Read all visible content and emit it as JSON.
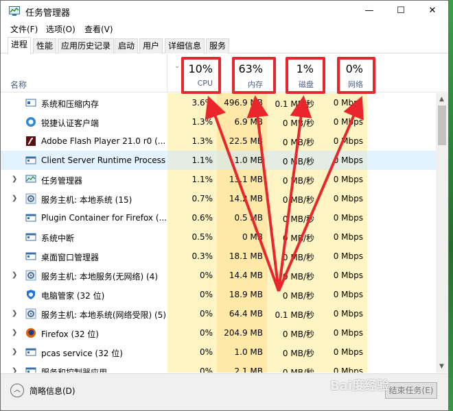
{
  "window": {
    "title": "任务管理器"
  },
  "window_controls": {
    "minimize": "—",
    "maximize": "☐",
    "close": "✕"
  },
  "menu": [
    "文件(F)",
    "选项(O)",
    "查看(V)"
  ],
  "tabs": [
    "进程",
    "性能",
    "应用历史记录",
    "启动",
    "用户",
    "详细信息",
    "服务"
  ],
  "active_tab": "进程",
  "header": {
    "name_label": "名称",
    "cpu": {
      "percent": "10%",
      "label": "CPU"
    },
    "memory": {
      "percent": "63%",
      "label": "内存"
    },
    "disk": {
      "percent": "1%",
      "label": "磁盘"
    },
    "network": {
      "percent": "0%",
      "label": "网络"
    }
  },
  "processes": [
    {
      "name": "系统和压缩内存",
      "cpu": "3.6%",
      "mem": "496.9 MB",
      "disk": "0.1 MB/秒",
      "net": "0 Mbps",
      "expandable": false,
      "icon": "system-icon"
    },
    {
      "name": "锐捷认证客户端",
      "cpu": "1.3%",
      "mem": "6.9 MB",
      "disk": "0 MB/秒",
      "net": "0 Mbps",
      "expandable": false,
      "icon": "ruijie-icon"
    },
    {
      "name": "Adobe Flash Player 21.0 r0 (...",
      "cpu": "1.3%",
      "mem": "22.5 MB",
      "disk": "0 MB/秒",
      "net": "0 Mbps",
      "expandable": false,
      "icon": "flash-icon"
    },
    {
      "name": "Client Server Runtime Process",
      "cpu": "1.1%",
      "mem": "1.0 MB",
      "disk": "0 MB/秒",
      "net": "0 Mbps",
      "expandable": false,
      "icon": "window-icon",
      "selected": true
    },
    {
      "name": "任务管理器",
      "cpu": "1.1%",
      "mem": "13.1 MB",
      "disk": "0 MB/秒",
      "net": "0 Mbps",
      "expandable": true,
      "icon": "taskmgr-icon"
    },
    {
      "name": "服务主机: 本地系统 (15)",
      "cpu": "0.7%",
      "mem": "14.2 MB",
      "disk": "0 MB/秒",
      "net": "0 Mbps",
      "expandable": true,
      "icon": "gear-icon"
    },
    {
      "name": "Plugin Container for Firefox (...",
      "cpu": "0.6%",
      "mem": "0.5 MB",
      "disk": "0 MB/秒",
      "net": "0 Mbps",
      "expandable": false,
      "icon": "window-icon"
    },
    {
      "name": "系统中断",
      "cpu": "0.5%",
      "mem": "0 MB",
      "disk": "0 MB/秒",
      "net": "0 Mbps",
      "expandable": false,
      "icon": "window-icon"
    },
    {
      "name": "桌面窗口管理器",
      "cpu": "0.3%",
      "mem": "18.1 MB",
      "disk": "0 MB/秒",
      "net": "0 Mbps",
      "expandable": false,
      "icon": "window-icon"
    },
    {
      "name": "服务主机: 本地服务(无网络) (4)",
      "cpu": "0%",
      "mem": "14.4 MB",
      "disk": "0 MB/秒",
      "net": "0 Mbps",
      "expandable": true,
      "icon": "gear-icon"
    },
    {
      "name": "电脑管家 (32 位)",
      "cpu": "0%",
      "mem": "18.9 MB",
      "disk": "0 MB/秒",
      "net": "0 Mbps",
      "expandable": false,
      "icon": "shield-icon"
    },
    {
      "name": "服务主机: 本地系统(网络受限) (5)",
      "cpu": "0%",
      "mem": "64.4 MB",
      "disk": "0.1 MB/秒",
      "net": "0 Mbps",
      "expandable": true,
      "icon": "gear-icon"
    },
    {
      "name": "Firefox (32 位)",
      "cpu": "0%",
      "mem": "204.9 MB",
      "disk": "0 MB/秒",
      "net": "0 Mbps",
      "expandable": true,
      "icon": "firefox-icon"
    },
    {
      "name": "pcas service (32 位)",
      "cpu": "0%",
      "mem": "1.0 MB",
      "disk": "0 MB/秒",
      "net": "0 Mbps",
      "expandable": true,
      "icon": "window-icon"
    },
    {
      "name": "服务和控制器应用",
      "cpu": "0%",
      "mem": "2.1 MB",
      "disk": "0 MB/秒",
      "net": "0 Mbps",
      "expandable": true,
      "icon": "window-icon"
    }
  ],
  "footer": {
    "fewer_details": "简略信息(D)",
    "end_task": "结束任务(E)"
  },
  "watermark": "Bai度经验",
  "colors": {
    "heat_light": "#fff4c4",
    "heat_mid": "#ffe8a8",
    "heat_strong": "#ffd274",
    "annotation_red": "#e8262c",
    "selected_row": "#e5f3fb"
  }
}
